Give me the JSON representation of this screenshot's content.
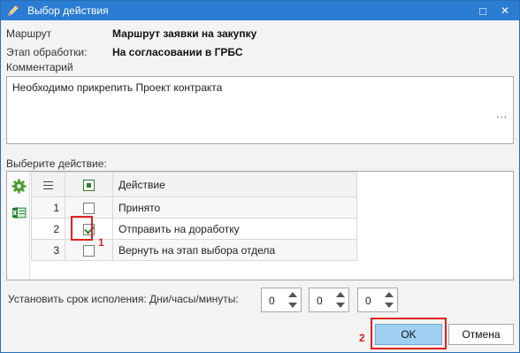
{
  "window": {
    "title": "Выбор действия",
    "maximize_glyph": "□",
    "close_glyph": "✕"
  },
  "fields": {
    "route_label": "Маршрут",
    "route_value": "Маршрут заявки на закупку",
    "stage_label": "Этап обработки:",
    "stage_value": "На согласовании в ГРБС",
    "comment_label": "Комментарий"
  },
  "comment": {
    "text": "Необходимо прикрепить Проект контракта",
    "more": "..."
  },
  "actions": {
    "label": "Выберите действие:",
    "column_header": "Действие",
    "rows": [
      {
        "num": "1",
        "label": "Принято",
        "checked": false
      },
      {
        "num": "2",
        "label": "Отправить на доработку",
        "checked": true
      },
      {
        "num": "3",
        "label": "Вернуть на этап выбора отдела",
        "checked": false
      }
    ]
  },
  "annotations": {
    "marker_1": "1",
    "marker_2": "2",
    "color": "#e02020"
  },
  "deadline": {
    "label": "Установить срок исполения: Дни/часы/минуты:",
    "days": "0",
    "hours": "0",
    "minutes": "0"
  },
  "buttons": {
    "ok": "OK",
    "cancel": "Отмена"
  },
  "icons": {
    "app": "pencil-icon",
    "settings": "gear-icon",
    "excel": "excel-icon",
    "columns": "list-icon"
  },
  "colors": {
    "titlebar": "#2b7cd3",
    "ok_button": "#9fd0f2",
    "check": "#2d7d2d"
  }
}
